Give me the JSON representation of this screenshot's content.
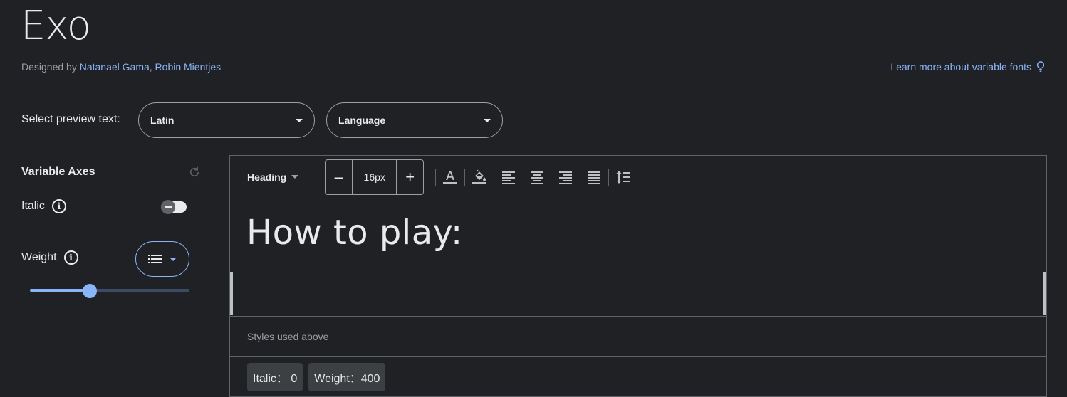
{
  "header": {
    "title": "Exo",
    "designed_by_prefix": "Designed by ",
    "designers": "Natanael Gama, Robin Mientjes",
    "learn_more": "Learn more about variable fonts"
  },
  "preview_select": {
    "label": "Select preview text:",
    "script_value": "Latin",
    "language_value": "Language"
  },
  "axes": {
    "title": "Variable Axes",
    "italic_label": "Italic",
    "italic_on": false,
    "weight_label": "Weight",
    "weight_fraction": 0.375
  },
  "toolbar": {
    "style_label": "Heading",
    "minus": "–",
    "size_value": "16px",
    "plus": "+"
  },
  "preview": {
    "text": "How to play:"
  },
  "styles": {
    "label": "Styles used above",
    "chips": [
      "Italic： 0",
      "Weight：400"
    ]
  },
  "colors": {
    "background": "#202124",
    "accent": "#8ab4f8",
    "text": "#e8eaed",
    "muted": "#9aa0a6"
  }
}
